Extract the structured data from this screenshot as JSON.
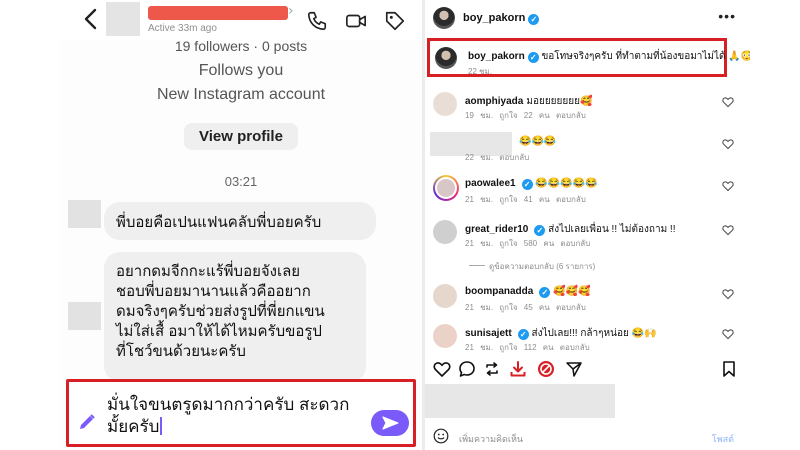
{
  "dm": {
    "status": "Active 33m ago",
    "followers_line": "19 followers · 0 posts",
    "follows_you": "Follows you",
    "account_note": "New Instagram account",
    "view_profile": "View profile",
    "time_divider": "03:21",
    "messages": [
      {
        "text": "พี่บอยคือเปนแฟนคลับพี่บอยครับ"
      },
      {
        "lines": [
          "อยากดมจีกกะแร้พี่บอยจังเลย",
          "ชอบพี่บอยมานานแล้วคืออยาก",
          "ดมจริงๆครับช่วยส่งรูปที่พี่ยกแขน",
          "ไม่ใส่เสื้ อมาให้ได้ไหมครับขอรูป",
          "ที่โชว์ขนด้วยนะครับ"
        ]
      }
    ],
    "composer_lines": [
      "มั่นใจขนตรูดมากกว่าครับ สะดวก",
      "มั้ยครับ"
    ],
    "accent_color": "#7a5af8",
    "highlight_color": "#d81f26"
  },
  "post": {
    "username": "boy_pakorn",
    "caption": {
      "username": "boy_pakorn",
      "text": "ขอโทษจริงๆครับ ที่ทำตามที่น้องขอมาไม่ได้ 🙏😳😆",
      "time": "22 ชม."
    },
    "comments": [
      {
        "user": "aomphiyada",
        "text": "มอยยยยยยย🥰",
        "meta": "19 ชม. ถูกใจ 22 คน ตอบกลับ",
        "verified": false
      },
      {
        "user": "",
        "text": "😂😂😂",
        "meta": "22 ชม. ตอบกลับ",
        "verified": false
      },
      {
        "user": "paowalee1",
        "text": "😂😂😂😂😂",
        "meta": "21 ชม. ถูกใจ 41 คน ตอบกลับ",
        "verified": true
      },
      {
        "user": "great_rider10",
        "text": "ส่งไปเลยเพื่อน !! ไม่ต้องถาม !!",
        "meta": "21 ชม. ถูกใจ 580 คน ตอบกลับ",
        "verified": true
      },
      {
        "user": "boompanadda",
        "text": "🥰🥰🥰",
        "meta": "21 ชม. ถูกใจ 45 คน ตอบกลับ",
        "verified": true
      },
      {
        "user": "sunisajett",
        "text": "ส่งไปเลย!!! กล้าๆหน่อย 😂🙌",
        "meta": "21 ชม. ถูกใจ 112 คน ตอบกลับ",
        "verified": true
      }
    ],
    "view_replies": "ดูข้อความตอบกลับ (6 รายการ)",
    "comment_placeholder": "เพิ่มความคิดเห็น",
    "post_button": "โพสต์"
  }
}
